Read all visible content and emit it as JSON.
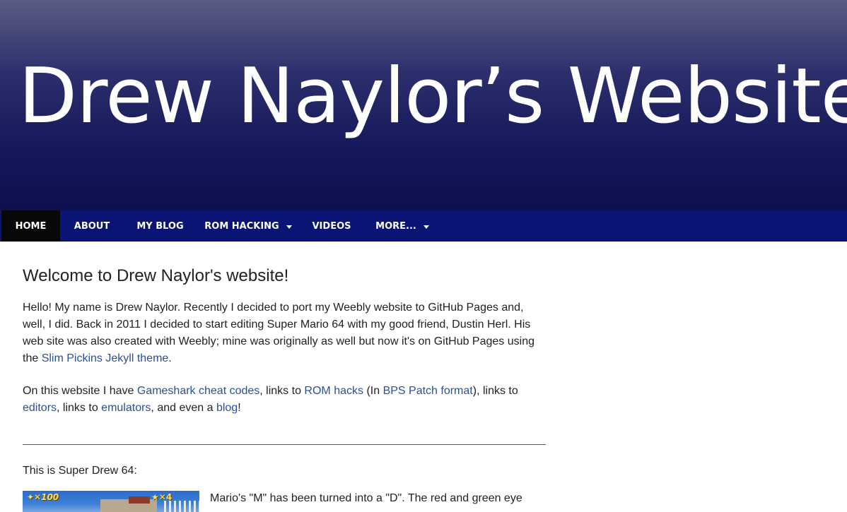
{
  "header": {
    "site_title": "Drew Naylor’s Website"
  },
  "nav": {
    "items": [
      {
        "label": "HOME",
        "active": true,
        "dropdown": false
      },
      {
        "label": "ABOUT",
        "active": false,
        "dropdown": false
      },
      {
        "label": "MY BLOG",
        "active": false,
        "dropdown": false
      },
      {
        "label": "ROM HACKING",
        "active": false,
        "dropdown": true
      },
      {
        "label": "VIDEOS",
        "active": false,
        "dropdown": false
      },
      {
        "label": "MORE...",
        "active": false,
        "dropdown": true
      }
    ]
  },
  "main": {
    "heading": "Welcome to Drew Naylor's website!",
    "intro": {
      "text_before_link": "Hello! My name is Drew Naylor. Recently I decided to port my Weebly website to GitHub Pages and, well, I did. Back in 2011 I decided to start editing Super Mario 64 with my good friend, Dustin Herl. His web site was also created with Weebly; mine was originally as well but now it's on GitHub Pages using the ",
      "link_theme": "Slim Pickins Jekyll theme",
      "text_after_link": "."
    },
    "links_paragraph": {
      "t1": "On this website I have ",
      "link_gameshark": "Gameshark cheat codes",
      "t2": ", links to ",
      "link_rom_hacks": "ROM hacks",
      "t3": " (In ",
      "link_bps": "BPS Patch format",
      "t4": "), links to ",
      "link_editors": "editors",
      "t5": ", links to ",
      "link_emulators": "emulators",
      "t6": ", and even a ",
      "link_blog": "blog",
      "t7": "!"
    },
    "super_drew_caption": "This is Super Drew 64:",
    "image_hud": {
      "left": "✦✕100",
      "right": "★✕4"
    },
    "image_description": "Mario's \"M\" has been turned into a \"D\". The red and green eye"
  },
  "colors": {
    "nav_bg": "#091475",
    "nav_active_bg": "#080808",
    "link": "#2a4f9c",
    "header_top": "#5a5c84",
    "header_bottom": "#0d104e"
  }
}
